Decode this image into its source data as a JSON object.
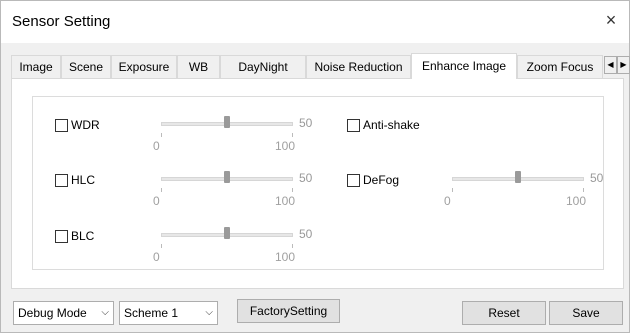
{
  "window": {
    "title": "Sensor Setting",
    "close_glyph": "×"
  },
  "tabs": [
    {
      "label": "Image"
    },
    {
      "label": "Scene"
    },
    {
      "label": "Exposure"
    },
    {
      "label": "WB"
    },
    {
      "label": "DayNight"
    },
    {
      "label": "Noise Reduction"
    },
    {
      "label": "Enhance Image",
      "active": true
    },
    {
      "label": "Zoom Focus"
    }
  ],
  "tab_scroll": {
    "left": "◀",
    "right": "▶"
  },
  "options": {
    "wdr": {
      "label": "WDR",
      "checked": false,
      "slider": {
        "value": "50",
        "min": "0",
        "max": "100",
        "fraction": 0.5
      }
    },
    "hlc": {
      "label": "HLC",
      "checked": false,
      "slider": {
        "value": "50",
        "min": "0",
        "max": "100",
        "fraction": 0.5
      }
    },
    "blc": {
      "label": "BLC",
      "checked": false,
      "slider": {
        "value": "50",
        "min": "0",
        "max": "100",
        "fraction": 0.5
      }
    },
    "antishake": {
      "label": "Anti-shake",
      "checked": false
    },
    "defog": {
      "label": "DeFog",
      "checked": false,
      "slider": {
        "value": "50",
        "min": "0",
        "max": "100",
        "fraction": 0.5
      }
    }
  },
  "footer": {
    "mode_select": "Debug Mode",
    "scheme_select": "Scheme 1",
    "factory_label": "FactorySetting",
    "reset_label": "Reset",
    "save_label": "Save"
  }
}
